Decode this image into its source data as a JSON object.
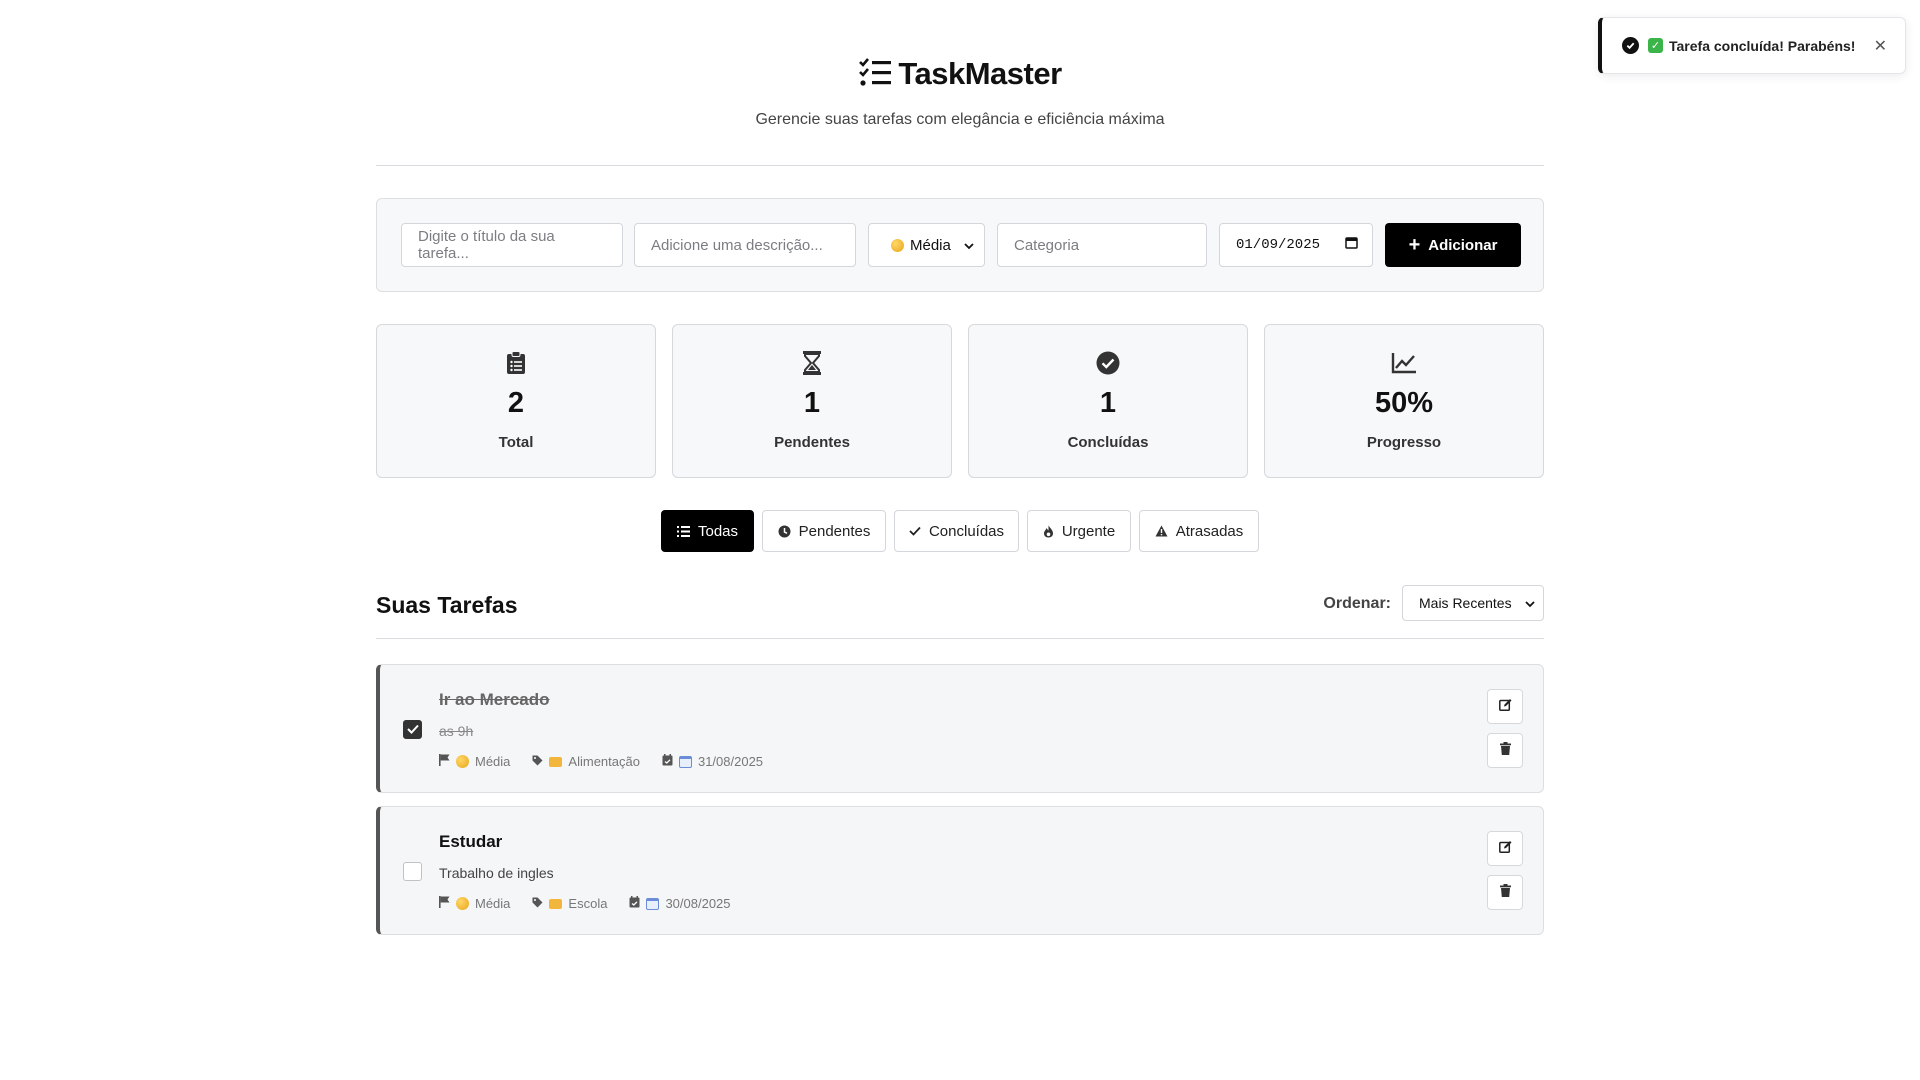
{
  "toast": {
    "message": "Tarefa concluída! Parabéns!",
    "emoji_name": "check-mark-emoji"
  },
  "header": {
    "app_name": "TaskMaster",
    "subtitle": "Gerencie suas tarefas com elegância e eficiência máxima"
  },
  "form": {
    "title_placeholder": "Digite o título da sua tarefa...",
    "description_placeholder": "Adicione uma descrição...",
    "priority_selected": "Média",
    "category_placeholder": "Categoria",
    "date_value": "01/09/2025",
    "add_label": "Adicionar"
  },
  "stats": [
    {
      "value": "2",
      "label": "Total",
      "icon": "clipboard-list-icon"
    },
    {
      "value": "1",
      "label": "Pendentes",
      "icon": "hourglass-icon"
    },
    {
      "value": "1",
      "label": "Concluídas",
      "icon": "check-circle-icon"
    },
    {
      "value": "50%",
      "label": "Progresso",
      "icon": "line-chart-icon"
    }
  ],
  "filters": [
    {
      "label": "Todas",
      "active": true
    },
    {
      "label": "Pendentes",
      "active": false
    },
    {
      "label": "Concluídas",
      "active": false
    },
    {
      "label": "Urgente",
      "active": false
    },
    {
      "label": "Atrasadas",
      "active": false
    }
  ],
  "tasks_section": {
    "title": "Suas Tarefas",
    "sort_label": "Ordenar:",
    "sort_selected": "Mais Recentes"
  },
  "tasks": [
    {
      "title": "Ir ao Mercado",
      "description": "as 9h",
      "priority": "Média",
      "category": "Alimentação",
      "date": "31/08/2025",
      "completed": true
    },
    {
      "title": "Estudar",
      "description": "Trabalho de ingles",
      "priority": "Média",
      "category": "Escola",
      "date": "30/08/2025",
      "completed": false
    }
  ],
  "colors": {
    "accent": "#000000",
    "panel": "#f7f8f9",
    "border": "#dcdee1",
    "priority_medium": "#f0b429"
  }
}
